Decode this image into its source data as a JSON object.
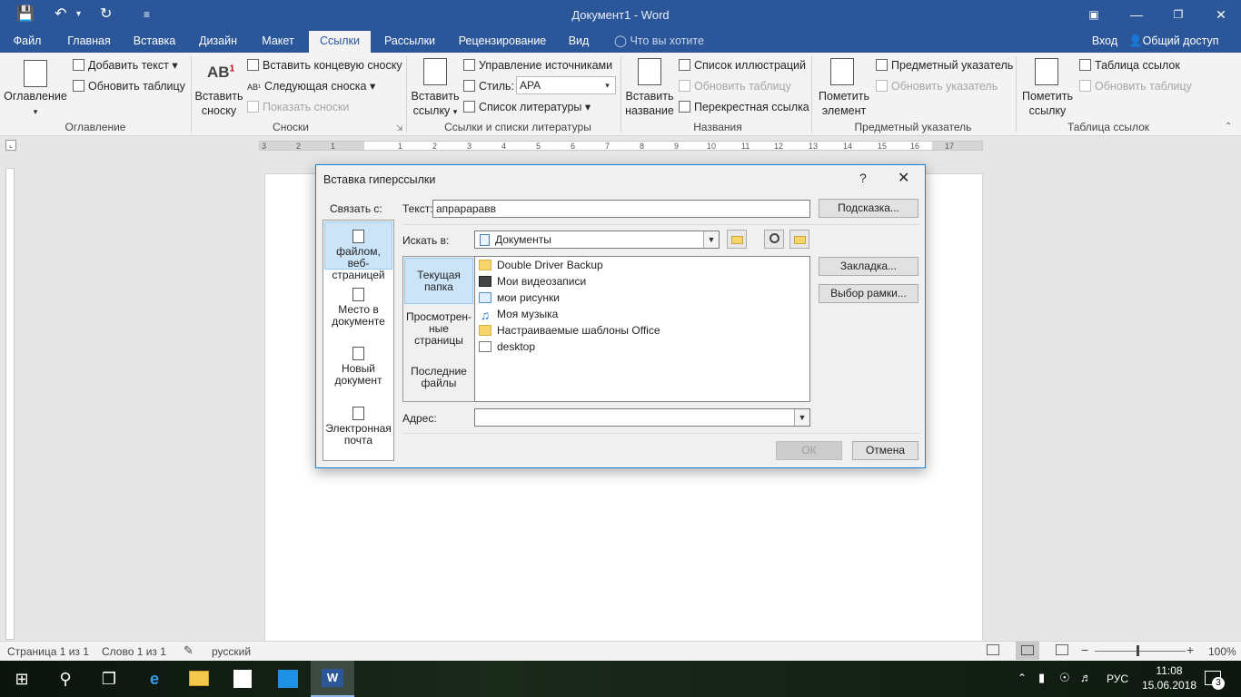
{
  "window": {
    "title": "Документ1 - Word"
  },
  "tabs": [
    "Файл",
    "Главная",
    "Вставка",
    "Дизайн",
    "Макет",
    "Ссылки",
    "Рассылки",
    "Рецензирование",
    "Вид"
  ],
  "tell_me": "Что вы хотите сделать?",
  "account": {
    "signin": "Вход",
    "share": "Общий доступ"
  },
  "ribbon": {
    "toc": {
      "label": "Оглавление",
      "add_text": "Добавить текст",
      "update": "Обновить таблицу",
      "group": "Оглавление"
    },
    "footnotes": {
      "insert_l1": "Вставить",
      "insert_l2": "сноску",
      "endnote": "Вставить концевую сноску",
      "next": "Следующая сноска",
      "show": "Показать сноски",
      "group": "Сноски"
    },
    "citations": {
      "insert_l1": "Вставить",
      "insert_l2": "ссылку",
      "manage": "Управление источниками",
      "style_label": "Стиль:",
      "style_value": "APA",
      "bibliography": "Список литературы",
      "group": "Ссылки и списки литературы"
    },
    "captions": {
      "insert_l1": "Вставить",
      "insert_l2": "название",
      "list": "Список иллюстраций",
      "update": "Обновить таблицу",
      "crossref": "Перекрестная ссылка",
      "group": "Названия"
    },
    "index": {
      "mark_l1": "Пометить",
      "mark_l2": "элемент",
      "insert": "Предметный указатель",
      "update": "Обновить указатель",
      "group": "Предметный указатель"
    },
    "toa": {
      "mark_l1": "Пометить",
      "mark_l2": "ссылку",
      "insert": "Таблица ссылок",
      "update": "Обновить таблицу",
      "group": "Таблица ссылок"
    }
  },
  "ruler": {
    "ticks": [
      "3",
      "2",
      "1",
      "1",
      "2",
      "3",
      "4",
      "5",
      "6",
      "7",
      "8",
      "9",
      "10",
      "11",
      "12",
      "13",
      "14",
      "15",
      "16",
      "17"
    ]
  },
  "dialog": {
    "title": "Вставка гиперссылки",
    "help": "?",
    "link_to": "Связать с:",
    "link_options": [
      {
        "l1": "файлом, веб-",
        "l2": "страницей"
      },
      {
        "l1": "Место в",
        "l2": "документе"
      },
      {
        "l1": "Новый",
        "l2": "документ"
      },
      {
        "l1": "Электронная",
        "l2": "почта"
      }
    ],
    "text_label": "Текст:",
    "text_value": "апрарарaвв",
    "screentip": "Подсказка...",
    "look_in_label": "Искать в:",
    "look_in_value": "Документы",
    "sub_options": [
      {
        "l1": "Текущая",
        "l2": "папка"
      },
      {
        "l1": "Просмотрен-",
        "l2": "ные",
        "l3": "страницы"
      },
      {
        "l1": "Последние",
        "l2": "файлы"
      }
    ],
    "files": [
      "Double Driver Backup",
      "Мои видеозаписи",
      "мои рисунки",
      "Моя музыка",
      "Настраиваемые шаблоны Office",
      "desktop"
    ],
    "bookmark": "Закладка...",
    "target_frame": "Выбор рамки...",
    "address_label": "Адрес:",
    "address_value": "",
    "ok": "ОК",
    "cancel": "Отмена"
  },
  "status": {
    "page": "Страница 1 из 1",
    "words": "Слово 1 из 1",
    "lang": "русский",
    "zoom": "100%"
  },
  "taskbar": {
    "lang": "РУС",
    "time": "11:08",
    "date": "15.06.2018",
    "notif": "3"
  }
}
